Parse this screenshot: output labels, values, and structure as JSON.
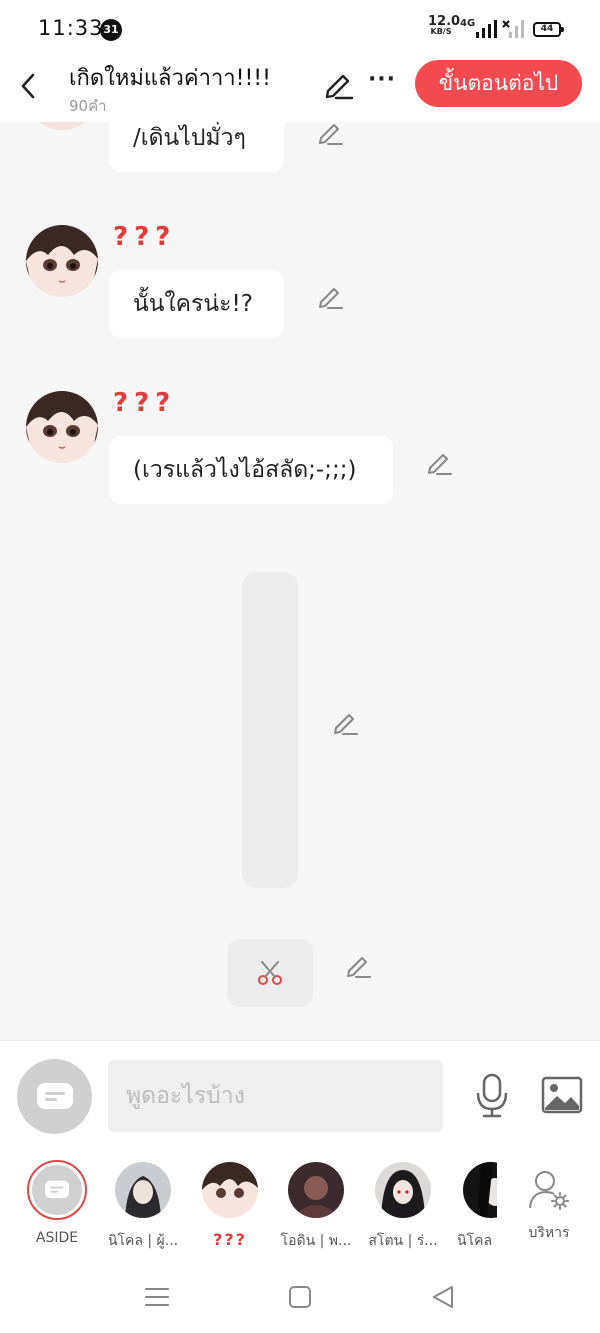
{
  "status_bar": {
    "time": "11:33",
    "notification_count": "31",
    "net_speed": "12.0",
    "net_unit": "KB/S",
    "network": "4G",
    "battery": "44"
  },
  "header": {
    "title": "เกิดใหม่แล้วค่าาา!!!!",
    "word_count": "90คำ",
    "more_label": "···",
    "next_button": "ขั้นตอนต่อไป"
  },
  "messages": [
    {
      "sender": "",
      "text": "/เดินไปมั่วๆ"
    },
    {
      "sender": "???",
      "text": "นั้นใครน่ะ!?"
    },
    {
      "sender": "???",
      "text": "(เวรแล้วไงไอ้สลัด;-;;;)"
    }
  ],
  "input": {
    "placeholder": "พูดอะไรบ้าง"
  },
  "characters": [
    {
      "name": "ASIDE"
    },
    {
      "name": "นิโคล | ผู้..."
    },
    {
      "name": "???"
    },
    {
      "name": "โอดิน | พ..."
    },
    {
      "name": "สโตน | ร่..."
    },
    {
      "name": "นิโคล |"
    },
    {
      "name": "บริหาร"
    }
  ],
  "colors": {
    "accent": "#f24a4f",
    "sender": "#e23b3b",
    "background": "#f6f6f6"
  },
  "icons": [
    "back-arrow-icon",
    "pencil-icon",
    "chat-bubble-icon",
    "microphone-icon",
    "image-icon",
    "scissors-icon",
    "manage-user-icon",
    "menu-icon",
    "home-square-icon",
    "back-triangle-icon"
  ]
}
